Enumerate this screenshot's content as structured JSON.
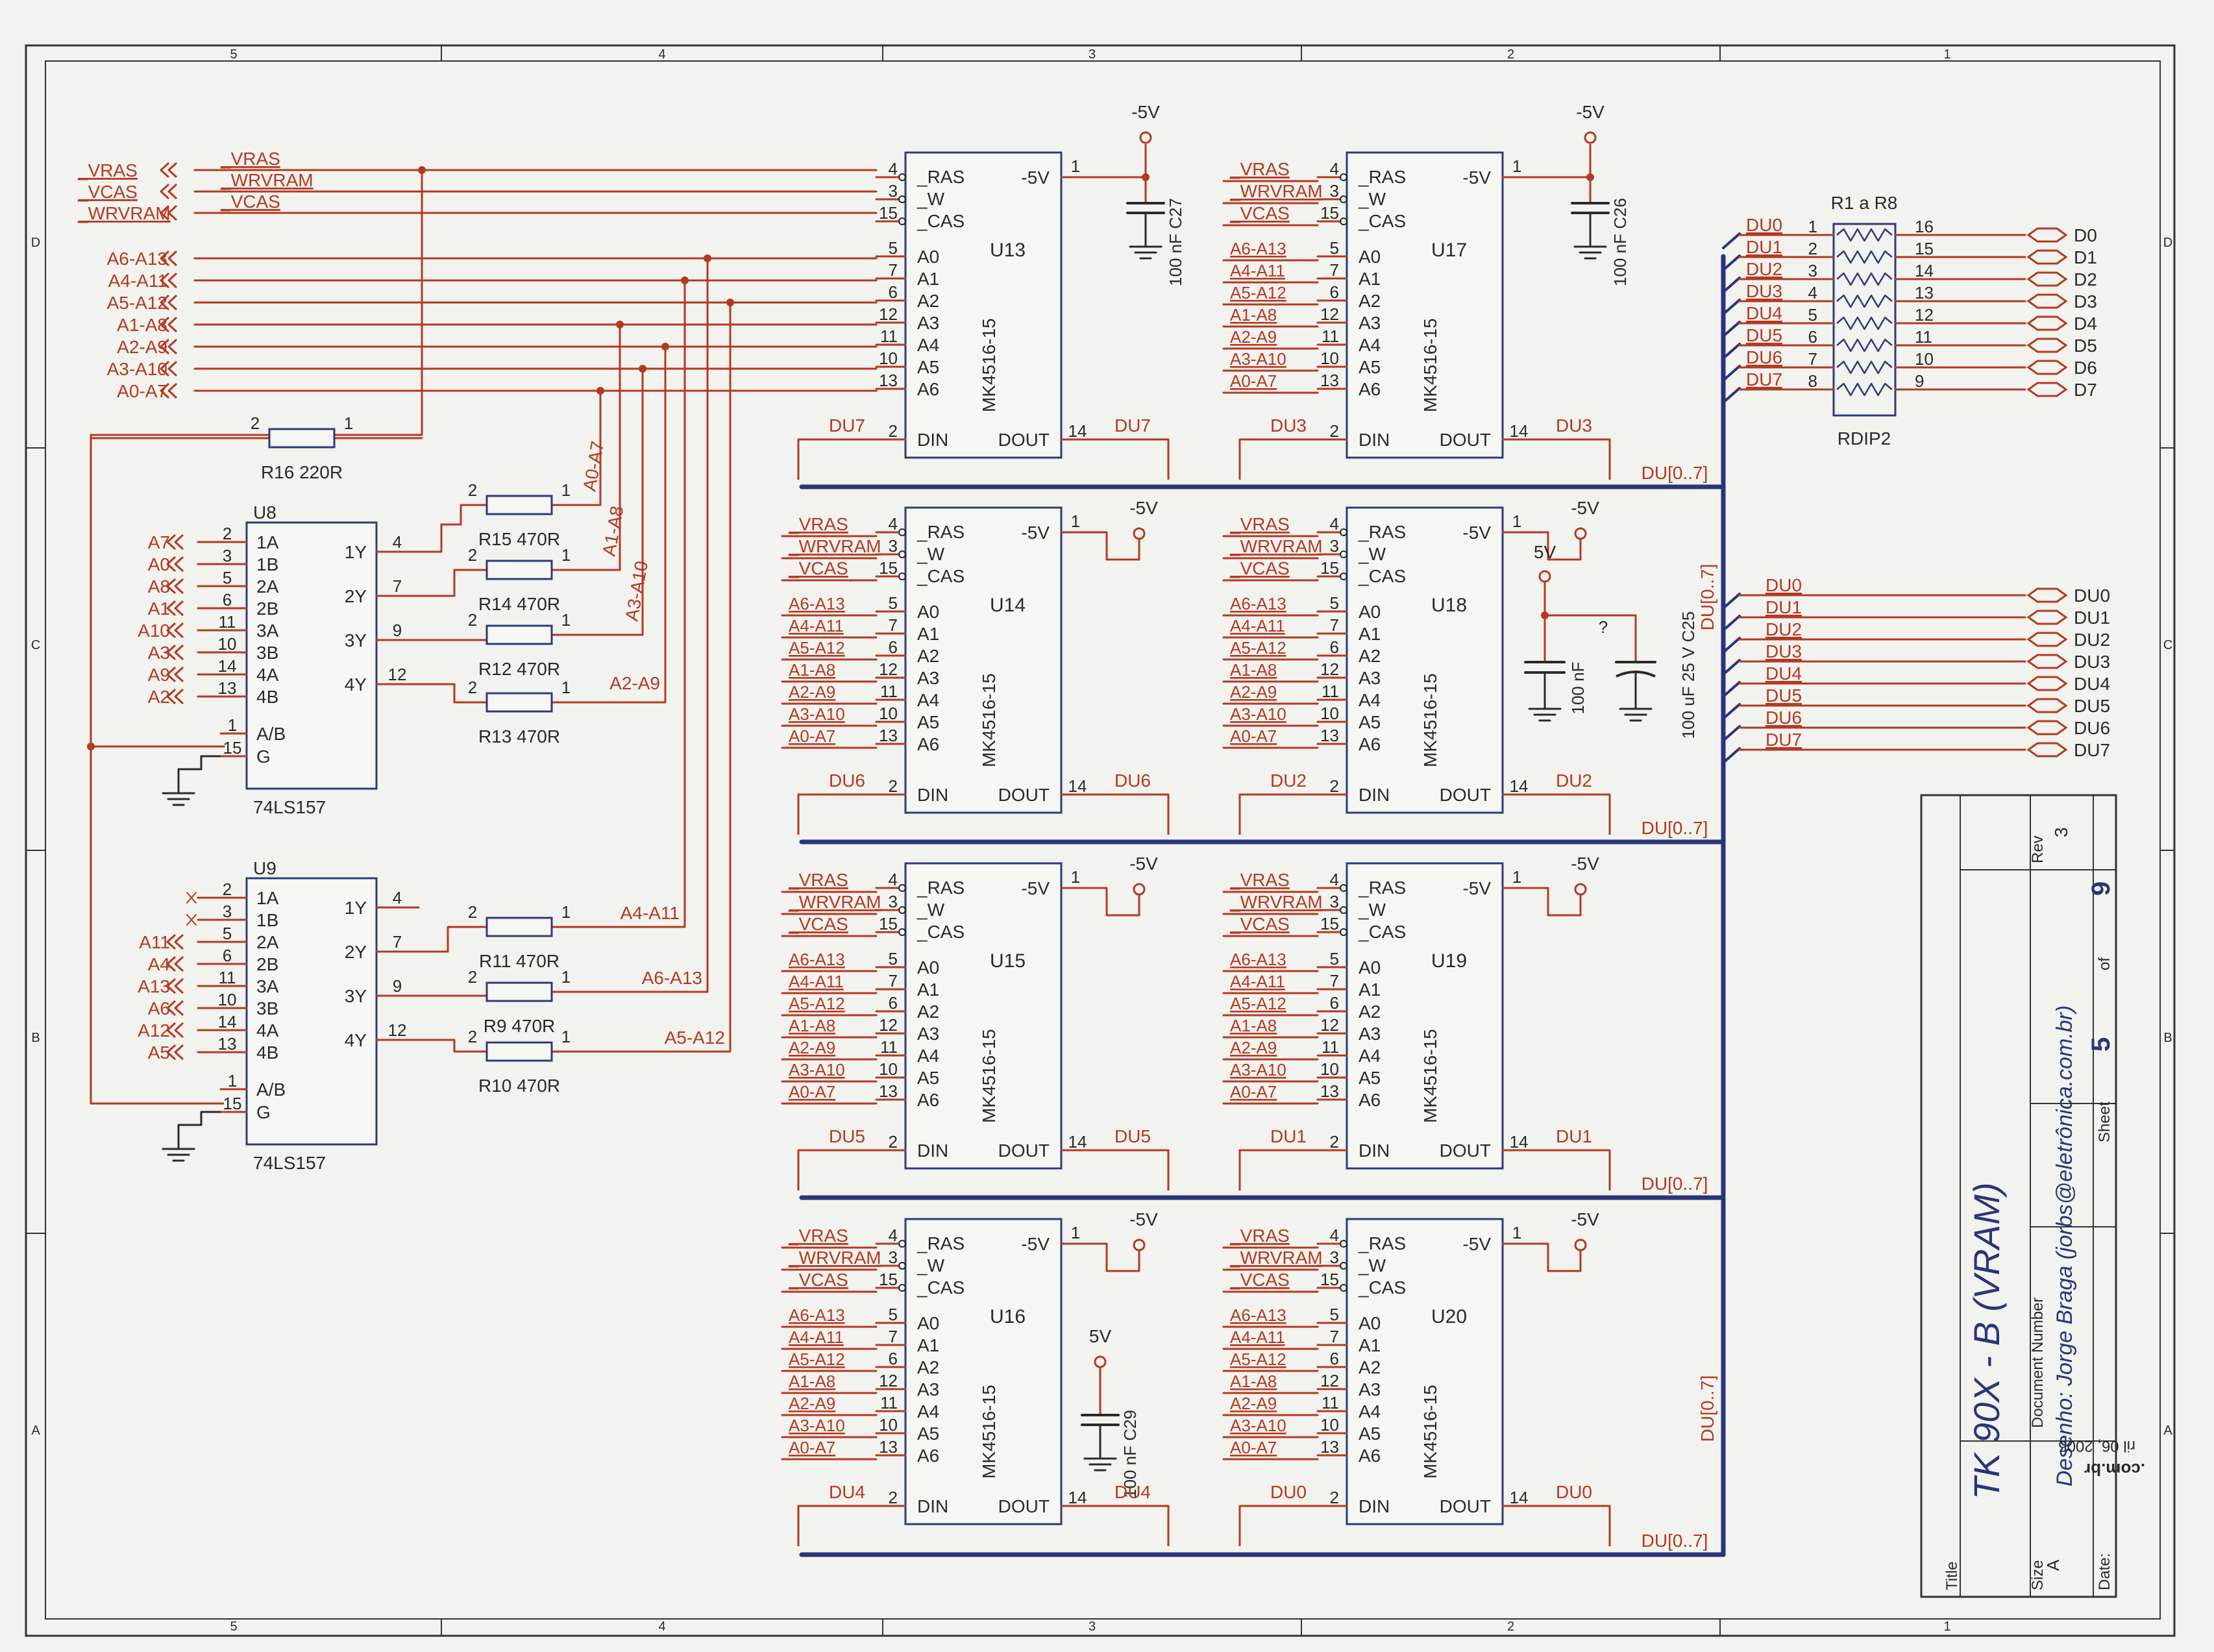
{
  "colors": {
    "wire": "#b33a22",
    "body": "#2f3a7a",
    "text": "#2a2a2a",
    "bus": "#2a3578",
    "paper": "#f2f2ee"
  },
  "border": {
    "cols": [
      "5",
      "4",
      "3",
      "2",
      "1"
    ],
    "rows": [
      "D",
      "C",
      "B",
      "A"
    ]
  },
  "input_nets": [
    "_VRAS",
    "_VCAS",
    "_WRVRAM"
  ],
  "control_nets": [
    "_VRAS",
    "_WRVRAM",
    "_VCAS"
  ],
  "addr_nets": [
    "A6-A13",
    "A4-A11",
    "A5-A12",
    "A1-A8",
    "A2-A9",
    "A3-A10",
    "A0-A7"
  ],
  "mem_pins": {
    "ctrl": [
      "_RAS",
      "_W",
      "_CAS"
    ],
    "ctrl_nums": [
      "4",
      "3",
      "15"
    ],
    "addr": [
      "A0",
      "A1",
      "A2",
      "A3",
      "A4",
      "A5",
      "A6"
    ],
    "addr_nums": [
      "5",
      "7",
      "6",
      "12",
      "11",
      "10",
      "13"
    ],
    "supply": "-5V",
    "supply_num": "1",
    "din": "DIN",
    "din_num": "2",
    "dout": "DOUT",
    "dout_num": "14",
    "part": "MK4516-15"
  },
  "chips": [
    {
      "ref": "U13",
      "data": "DU7"
    },
    {
      "ref": "U17",
      "data": "DU3"
    },
    {
      "ref": "U14",
      "data": "DU6"
    },
    {
      "ref": "U18",
      "data": "DU2"
    },
    {
      "ref": "U15",
      "data": "DU5"
    },
    {
      "ref": "U19",
      "data": "DU1"
    },
    {
      "ref": "U16",
      "data": "DU4"
    },
    {
      "ref": "U20",
      "data": "DU0"
    }
  ],
  "bus_label": "DU[0..7]",
  "supply_labels": {
    "neg": "-5V",
    "pos": "5V",
    "q": "?"
  },
  "caps": {
    "c27": "100 nF C27",
    "c26": "100 nF C26",
    "c25_small": "100 nF",
    "c25": "100 uF 25 V C25",
    "c29": "100 nF C29"
  },
  "mux": {
    "u8": {
      "ref": "U8",
      "part": "74LS157",
      "inputs": [
        "A7",
        "A0",
        "A8",
        "A1",
        "A10",
        "A3",
        "A9",
        "A2"
      ],
      "in_nums": [
        "2",
        "3",
        "5",
        "6",
        "11",
        "10",
        "14",
        "13"
      ],
      "in_pins": [
        "1A",
        "1B",
        "2A",
        "2B",
        "3A",
        "3B",
        "4A",
        "4B"
      ],
      "out_pins": [
        "1Y",
        "2Y",
        "3Y",
        "4Y"
      ],
      "out_nums": [
        "4",
        "7",
        "9",
        "12"
      ],
      "sel": "A/B",
      "sel_num": "1",
      "en": "G",
      "en_num": "15"
    },
    "u9": {
      "ref": "U9",
      "part": "74LS157",
      "inputs": [
        "",
        "",
        "A11",
        "A4",
        "A13",
        "A6",
        "A12",
        "A5"
      ],
      "in_nums": [
        "2",
        "3",
        "5",
        "6",
        "11",
        "10",
        "14",
        "13"
      ],
      "in_pins": [
        "1A",
        "1B",
        "2A",
        "2B",
        "3A",
        "3B",
        "4A",
        "4B"
      ],
      "out_pins": [
        "1Y",
        "2Y",
        "3Y",
        "4Y"
      ],
      "out_nums": [
        "4",
        "7",
        "9",
        "12"
      ],
      "sel": "A/B",
      "sel_num": "1",
      "en": "G",
      "en_num": "15"
    }
  },
  "resistors": [
    {
      "label": "R16 220R"
    },
    {
      "label": "R15 470R",
      "net": "A0-A7"
    },
    {
      "label": "R14 470R",
      "net": "A1-A8"
    },
    {
      "label": "R12 470R",
      "net": "A3-A10"
    },
    {
      "label": "R13 470R",
      "net": "A2-A9"
    },
    {
      "label": "R11 470R",
      "net": "A4-A11"
    },
    {
      "label": "R9  470R",
      "net": "A6-A13"
    },
    {
      "label": "R10 470R",
      "net": "A5-A12"
    }
  ],
  "rpin": {
    "one": "1",
    "two": "2"
  },
  "rdip": {
    "ref": "R1 a R8",
    "part": "RDIP2",
    "left": [
      "DU0",
      "DU1",
      "DU2",
      "DU3",
      "DU4",
      "DU5",
      "DU6",
      "DU7"
    ],
    "left_nums": [
      "1",
      "2",
      "3",
      "4",
      "5",
      "6",
      "7",
      "8"
    ],
    "right_nums": [
      "16",
      "15",
      "14",
      "13",
      "12",
      "11",
      "10",
      "9"
    ],
    "right": [
      "D0",
      "D1",
      "D2",
      "D3",
      "D4",
      "D5",
      "D6",
      "D7"
    ]
  },
  "du_ports": [
    "DU0",
    "DU1",
    "DU2",
    "DU3",
    "DU4",
    "DU5",
    "DU6",
    "DU7"
  ],
  "title_block": {
    "title_label": "Title",
    "title": "TK 90X - B  (VRAM)",
    "size_label": "Size",
    "size": "A",
    "docnum_label": "Document Number",
    "docnum": "Desenho: Jorge Braga (jorbs@eletrônica.com.br)",
    "rev_label": "Rev",
    "rev": "3",
    "date_label": "Date:",
    "sheet_label": "Sheet",
    "sheet": "5",
    "of_label": "of",
    "of": "9",
    "stamp1": "ril 06, 2005",
    "stamp2": ".com.br"
  }
}
